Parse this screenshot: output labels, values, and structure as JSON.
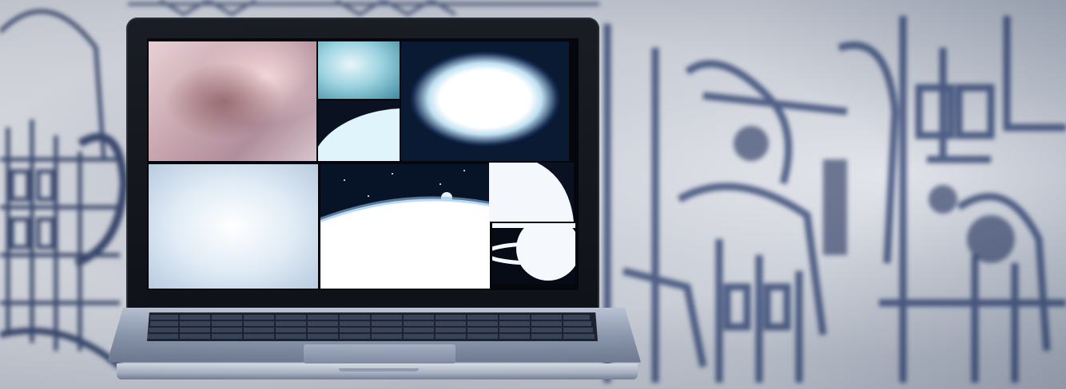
{
  "scene": {
    "description_name": "laptop-on-mural-background",
    "colors": {
      "mural_ink": "#1f2f5a",
      "mural_paper": "#d4d7de",
      "laptop_bezel": "#12151c",
      "laptop_aluminum": "#9aa4b6"
    },
    "screen_tiles": [
      "nebula-tile",
      "blue-cloud-tile",
      "planet-edge-tile",
      "bright-galaxy-tile",
      "hazy-sky-tile",
      "earth-horizon-tile",
      "white-shape-tile",
      "ringed-planet-tile"
    ]
  }
}
